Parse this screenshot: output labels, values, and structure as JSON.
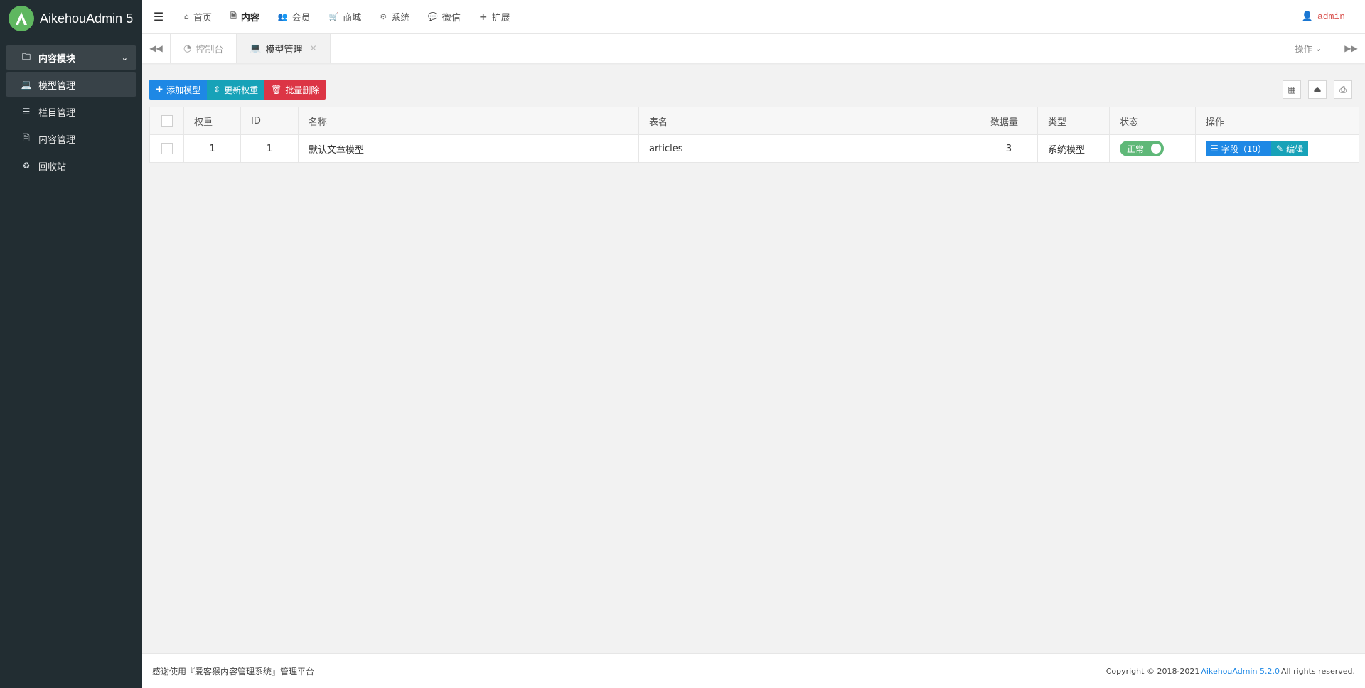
{
  "app": {
    "title": "AikehouAdmin 5"
  },
  "sidebar": {
    "group": {
      "label": "内容模块",
      "icon": "folder-icon"
    },
    "items": [
      {
        "label": "模型管理",
        "icon": "laptop-icon"
      },
      {
        "label": "栏目管理",
        "icon": "list-icon"
      },
      {
        "label": "内容管理",
        "icon": "file-icon"
      },
      {
        "label": "回收站",
        "icon": "recycle-icon"
      }
    ]
  },
  "topnav": {
    "items": [
      {
        "label": "首页",
        "icon": "home-icon"
      },
      {
        "label": "内容",
        "icon": "file-icon"
      },
      {
        "label": "会员",
        "icon": "users-icon"
      },
      {
        "label": "商城",
        "icon": "cart-icon"
      },
      {
        "label": "系统",
        "icon": "gears-icon"
      },
      {
        "label": "微信",
        "icon": "wechat-icon"
      },
      {
        "label": "扩展",
        "icon": "plus-icon"
      }
    ],
    "user": "admin"
  },
  "tabs": {
    "items": [
      {
        "label": "控制台"
      },
      {
        "label": "模型管理"
      }
    ],
    "ops_label": "操作"
  },
  "toolbar": {
    "add": "添加模型",
    "update_weight": "更新权重",
    "batch_delete": "批量删除"
  },
  "table": {
    "headers": [
      "权重",
      "ID",
      "名称",
      "表名",
      "数据量",
      "类型",
      "状态",
      "操作"
    ],
    "rows": [
      {
        "weight": "1",
        "id": "1",
        "name": "默认文章模型",
        "table": "articles",
        "count": "3",
        "type": "系统模型",
        "status": "正常",
        "fields_btn": "字段（10）",
        "edit_btn": "编辑"
      }
    ]
  },
  "footer": {
    "left": "感谢使用『爱客猴内容管理系统』管理平台",
    "copyright": "Copyright © 2018-2021",
    "link": "AikehouAdmin 5.2.0",
    "rights": "All rights reserved."
  },
  "colors": {
    "accent": "#1e88e5",
    "sidebar": "#222d32",
    "danger": "#dc3545",
    "info": "#17a2b8",
    "success": "#5fb878"
  }
}
